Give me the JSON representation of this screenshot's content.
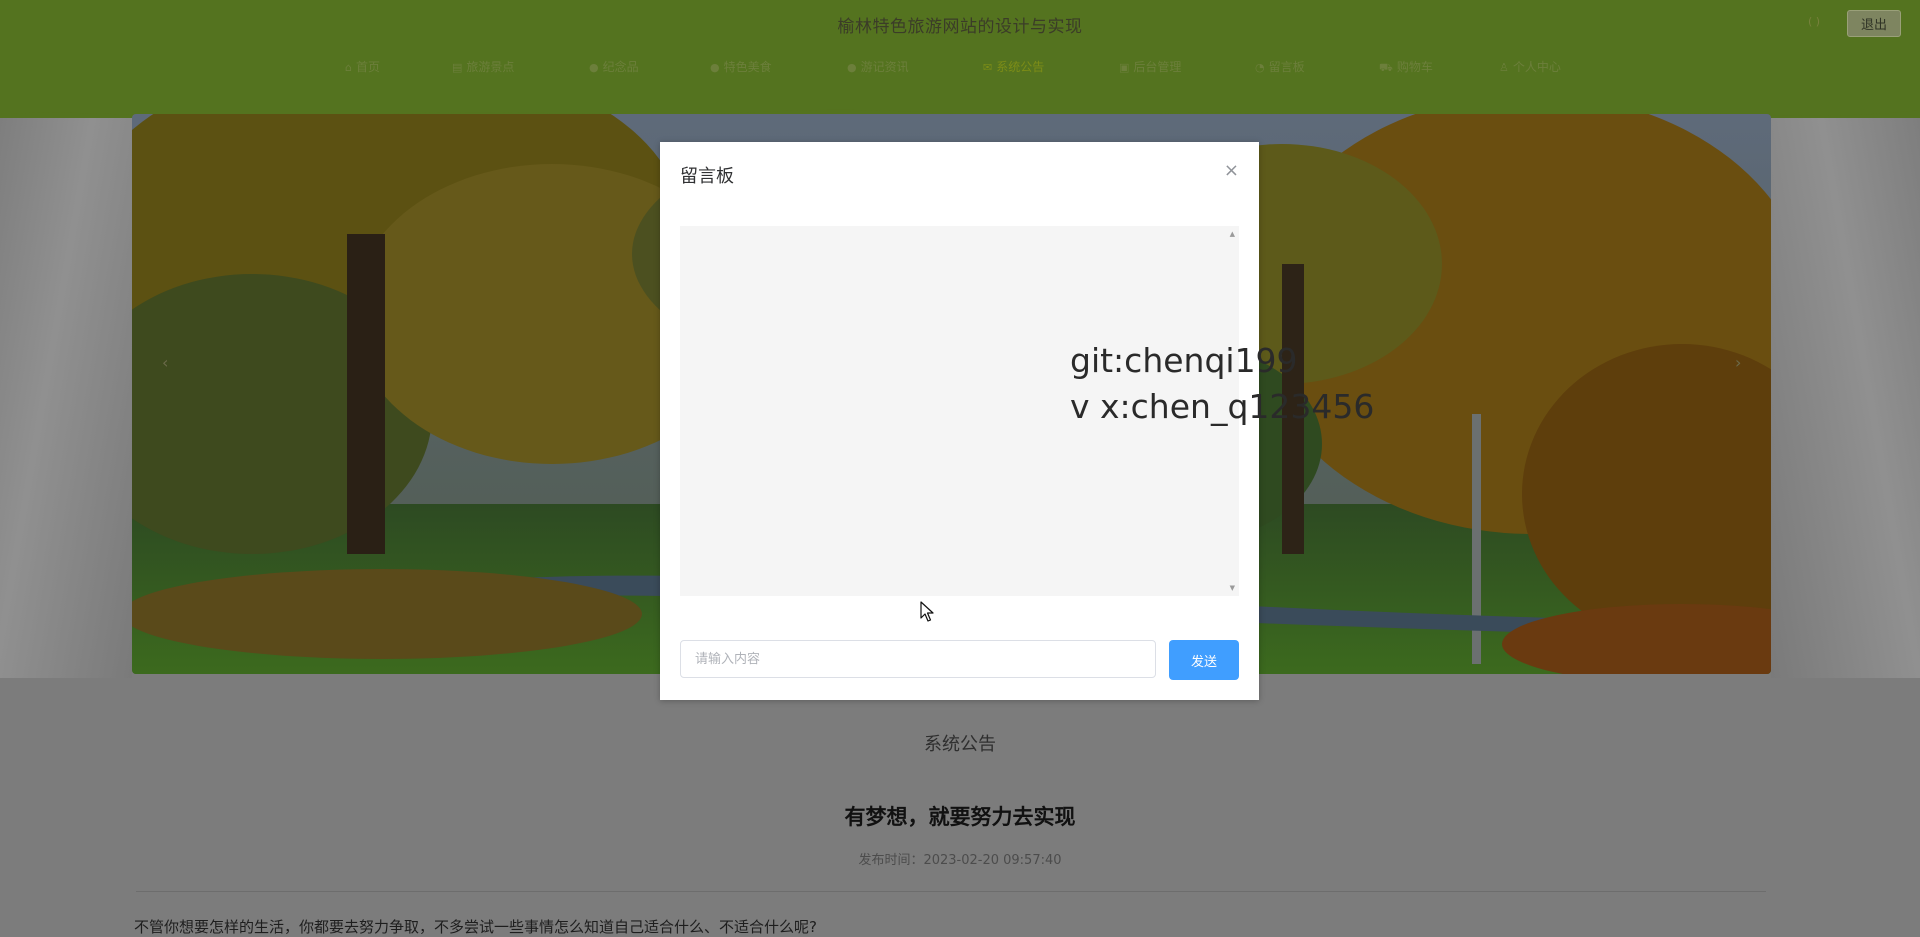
{
  "header": {
    "site_title": "榆林特色旅游网站的设计与实现",
    "user_label": "( )",
    "logout_label": "退出"
  },
  "nav": {
    "items": [
      {
        "icon": "home-icon",
        "glyph": "⌂",
        "label": "首页"
      },
      {
        "icon": "building-icon",
        "glyph": "▤",
        "label": "旅游景点"
      },
      {
        "icon": "circle-icon",
        "glyph": "●",
        "label": "纪念品"
      },
      {
        "icon": "circle-icon",
        "glyph": "●",
        "label": "特色美食"
      },
      {
        "icon": "circle-icon",
        "glyph": "●",
        "label": "游记资讯"
      },
      {
        "icon": "bell-icon",
        "glyph": "✉",
        "label": "系统公告"
      },
      {
        "icon": "console-icon",
        "glyph": "▣",
        "label": "后台管理"
      },
      {
        "icon": "message-icon",
        "glyph": "◔",
        "label": "留言板"
      },
      {
        "icon": "cart-icon",
        "glyph": "⛟",
        "label": "购物车"
      },
      {
        "icon": "user-icon",
        "glyph": "♙",
        "label": "个人中心"
      }
    ]
  },
  "modal": {
    "title": "留言板",
    "close_glyph": "×",
    "chat_watermark_line1": "git:chenqi199",
    "chat_watermark_line2": "v x:chen_q123456",
    "input_placeholder": "请输入内容",
    "input_value": "",
    "send_label": "发送"
  },
  "notice": {
    "section_title": "系统公告",
    "headline": "有梦想，就要努力去实现",
    "publish_time": "发布时间：2023-02-20 09:57:40",
    "body_text": "不管你想要怎样的生活，你都要去努力争取，不多尝试一些事情怎么知道自己适合什么、不适合什么呢?"
  },
  "colors": {
    "header_green": "#54731f",
    "active_nav": "#7d8d17",
    "send_button": "#409eff"
  }
}
